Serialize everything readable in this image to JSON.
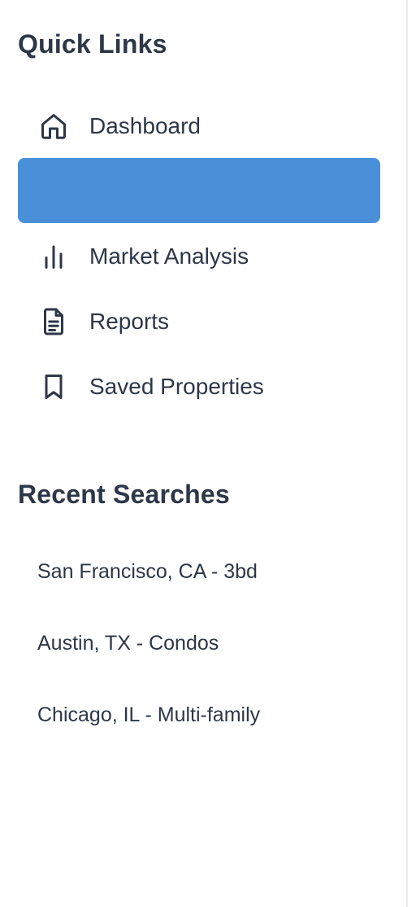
{
  "sidebar": {
    "quick_links": {
      "title": "Quick Links",
      "items": [
        {
          "label": "Dashboard",
          "icon": "home-icon"
        },
        {
          "label": "",
          "icon": ""
        },
        {
          "label": "Market Analysis",
          "icon": "bar-chart-icon"
        },
        {
          "label": "Reports",
          "icon": "document-icon"
        },
        {
          "label": "Saved Properties",
          "icon": "bookmark-icon"
        }
      ],
      "active_index": 1
    },
    "recent_searches": {
      "title": "Recent Searches",
      "items": [
        "San Francisco, CA - 3bd",
        "Austin, TX - Condos",
        "Chicago, IL - Multi-family"
      ]
    }
  },
  "colors": {
    "text": "#2d3748",
    "active_background": "#4a90d9",
    "border": "#e8ebef",
    "background": "#ffffff"
  }
}
